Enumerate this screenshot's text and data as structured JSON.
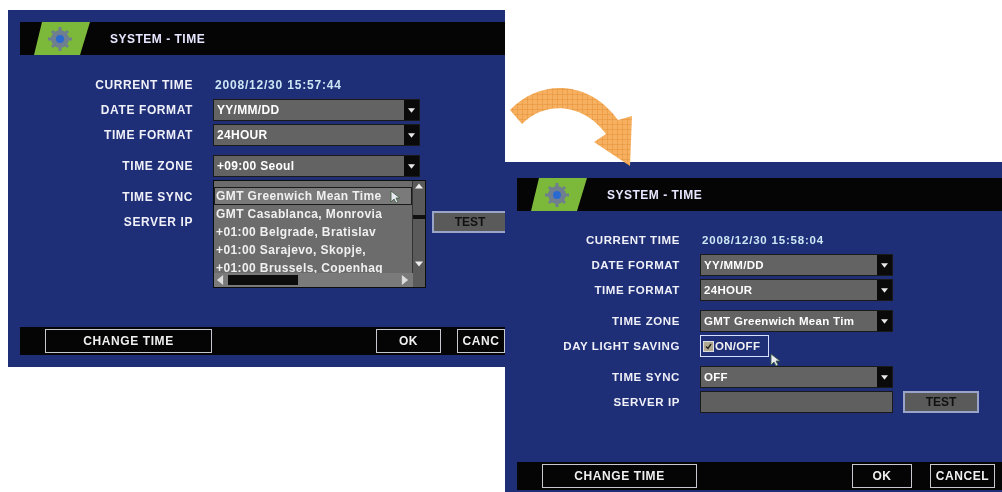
{
  "screens": [
    {
      "title": "SYSTEM - TIME",
      "groups": [
        [
          {
            "kind": "text",
            "label": "CURRENT TIME",
            "value": "2008/12/30 15:57:44"
          },
          {
            "kind": "select",
            "label": "DATE FORMAT",
            "value": "YY/MM/DD"
          },
          {
            "kind": "select",
            "label": "TIME FORMAT",
            "value": "24HOUR"
          }
        ],
        [
          {
            "kind": "select",
            "label": "TIME ZONE",
            "value": "+09:00 Seoul",
            "open": true,
            "options": [
              {
                "text": "GMT Greenwich Mean Time",
                "selected": true
              },
              {
                "text": "GMT Casablanca, Monrovia",
                "selected": false
              },
              {
                "text": "+01:00 Belgrade, Bratislav",
                "selected": false
              },
              {
                "text": "+01:00 Sarajevo, Skopje,",
                "selected": false
              },
              {
                "text": "+01:00 Brussels, Copenhag",
                "selected": false
              }
            ]
          }
        ],
        [
          {
            "kind": "label",
            "label": "TIME SYNC"
          },
          {
            "kind": "label",
            "label": "SERVER IP",
            "button": "TEST"
          }
        ]
      ],
      "footer_buttons": [
        "CHANGE TIME",
        "OK",
        "CANC"
      ]
    },
    {
      "title": "SYSTEM - TIME",
      "groups": [
        [
          {
            "kind": "text",
            "label": "CURRENT TIME",
            "value": "2008/12/30 15:58:04"
          },
          {
            "kind": "select",
            "label": "DATE FORMAT",
            "value": "YY/MM/DD"
          },
          {
            "kind": "select",
            "label": "TIME FORMAT",
            "value": "24HOUR"
          }
        ],
        [
          {
            "kind": "select",
            "label": "TIME ZONE",
            "value": "GMT Greenwich Mean Tim"
          },
          {
            "kind": "checkbox",
            "label": "DAY LIGHT SAVING",
            "text": "ON/OFF",
            "checked": true
          }
        ],
        [
          {
            "kind": "select",
            "label": "TIME SYNC",
            "value": "OFF"
          },
          {
            "kind": "input",
            "label": "SERVER IP",
            "button": "TEST"
          }
        ]
      ],
      "footer_buttons": [
        "CHANGE TIME",
        "OK",
        "CANCEL"
      ]
    }
  ]
}
